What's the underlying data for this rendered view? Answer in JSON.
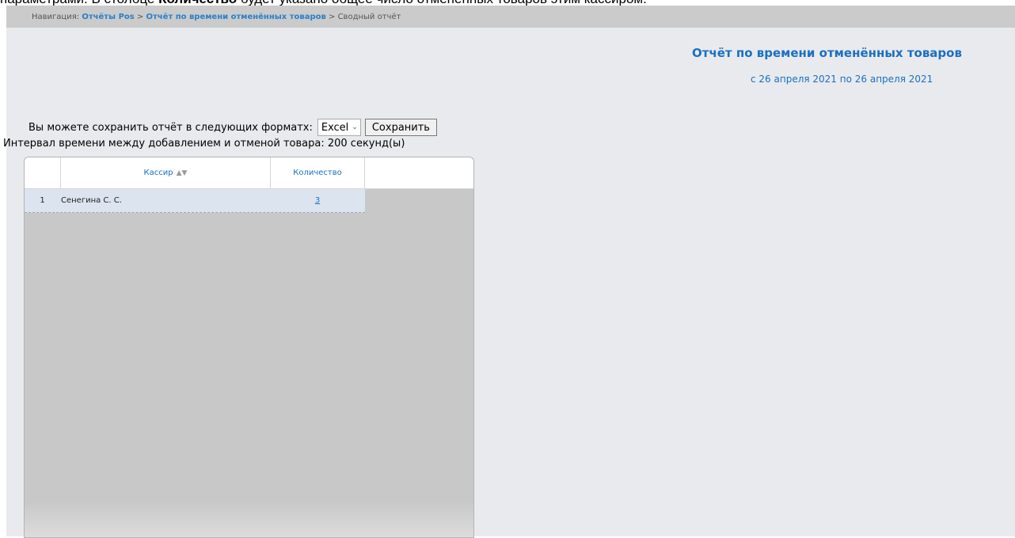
{
  "doc_text": {
    "part1": "параметрами. В столбце ",
    "bold": "Количество",
    "part2": " будет указано общее число отменённых товаров этим кассиром."
  },
  "navigation": {
    "label": "Навигация:",
    "crumb1": "Отчёты Pos",
    "sep1": ">",
    "crumb2": "Отчёт по времени отменённых товаров",
    "sep2": ">",
    "current": "Сводный отчёт"
  },
  "report": {
    "title": "Отчёт по времени отменённых товаров",
    "period": "с 26 апреля 2021 по 26 апреля 2021"
  },
  "save": {
    "label": "Вы можете сохранить отчёт в следующих форматх:",
    "format_selected": "Excel",
    "button_label": "Сохранить"
  },
  "interval_text": "Интервал времени между добавлением и отменой товара: 200 секунд(ы)",
  "table": {
    "columns": [
      "",
      "Кассир",
      "Количество",
      ""
    ],
    "rows": [
      {
        "index": "1",
        "cashier": "Сенегина С. С.",
        "quantity": "3"
      }
    ]
  },
  "icons": {
    "sort": "sort-arrows-icon",
    "dropdown": "chevron-down-icon"
  },
  "colors": {
    "accent": "#1a6fc2",
    "background": "#e8eaed",
    "grid_body": "#c8c8c8",
    "row_highlight": "#dbe4ef"
  }
}
